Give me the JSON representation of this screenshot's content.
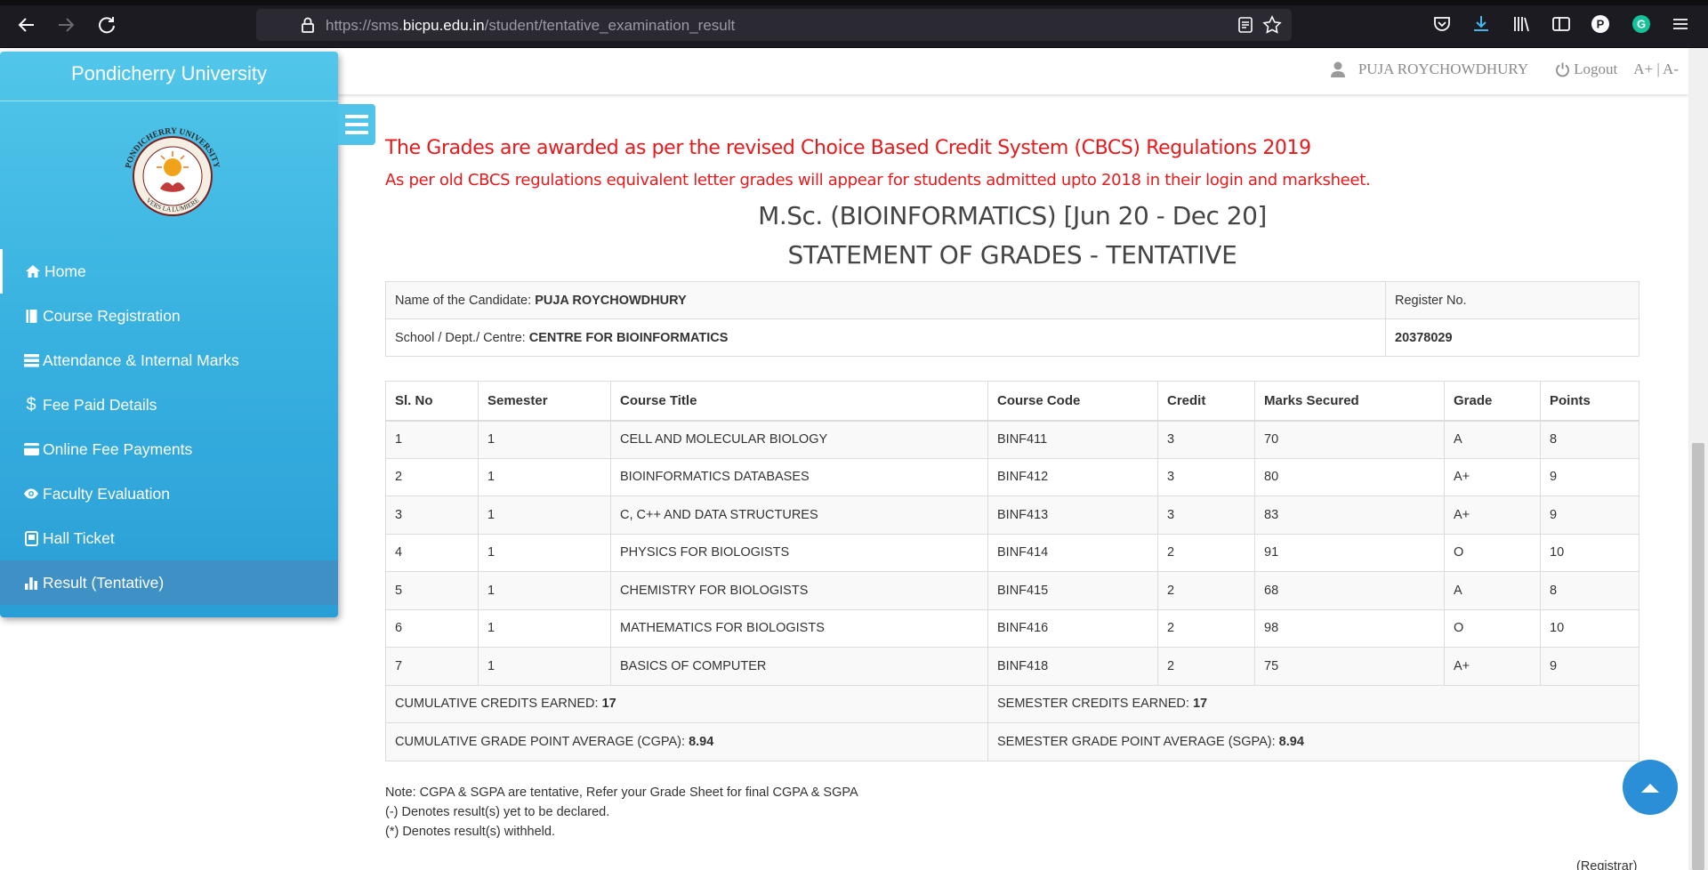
{
  "browser": {
    "url_prefix": "https://sms.",
    "url_host": "bicpu.edu.in",
    "url_path": "/student/tentative_examination_result"
  },
  "header": {
    "user_name": "PUJA ROYCHOWDHURY",
    "logout_label": "Logout",
    "font_size_controls": "A+ | A-"
  },
  "sidebar": {
    "title": "Pondicherry University",
    "logo_text_top": "PONDICHERRY UNIVERSITY",
    "logo_text_bottom": "VERS LA LUMIERE",
    "items": [
      {
        "label": "Home",
        "icon": "home-icon"
      },
      {
        "label": "Course Registration",
        "icon": "book-icon"
      },
      {
        "label": "Attendance & Internal Marks",
        "icon": "list-icon"
      },
      {
        "label": "Fee Paid Details",
        "icon": "dollar-icon"
      },
      {
        "label": "Online Fee Payments",
        "icon": "card-icon"
      },
      {
        "label": "Faculty Evaluation",
        "icon": "eye-icon"
      },
      {
        "label": "Hall Ticket",
        "icon": "ticket-icon"
      },
      {
        "label": "Result (Tentative)",
        "icon": "bar-chart-icon"
      }
    ]
  },
  "notices": {
    "line1": "The Grades are awarded as per the revised Choice Based Credit System (CBCS) Regulations 2019",
    "line2": "As per old CBCS regulations equivalent letter grades will appear for students admitted upto 2018 in their login and marksheet."
  },
  "titles": {
    "program": "M.Sc. (BIOINFORMATICS) [Jun 20 - Dec 20]",
    "statement": "STATEMENT OF GRADES - TENTATIVE"
  },
  "candidate": {
    "name_label": "Name of the Candidate: ",
    "name": "PUJA ROYCHOWDHURY",
    "register_label": "Register No.",
    "school_label": "School / Dept./ Centre: ",
    "school": "CENTRE FOR BIOINFORMATICS",
    "register_no": "20378029"
  },
  "grades": {
    "headers": [
      "Sl. No",
      "Semester",
      "Course Title",
      "Course Code",
      "Credit",
      "Marks Secured",
      "Grade",
      "Points"
    ],
    "rows": [
      [
        "1",
        "1",
        "CELL AND MOLECULAR BIOLOGY",
        "BINF411",
        "3",
        "70",
        "A",
        "8"
      ],
      [
        "2",
        "1",
        "BIOINFORMATICS DATABASES",
        "BINF412",
        "3",
        "80",
        "A+",
        "9"
      ],
      [
        "3",
        "1",
        "C, C++ AND DATA STRUCTURES",
        "BINF413",
        "3",
        "83",
        "A+",
        "9"
      ],
      [
        "4",
        "1",
        "PHYSICS FOR BIOLOGISTS",
        "BINF414",
        "2",
        "91",
        "O",
        "10"
      ],
      [
        "5",
        "1",
        "CHEMISTRY FOR BIOLOGISTS",
        "BINF415",
        "2",
        "68",
        "A",
        "8"
      ],
      [
        "6",
        "1",
        "MATHEMATICS FOR BIOLOGISTS",
        "BINF416",
        "2",
        "98",
        "O",
        "10"
      ],
      [
        "7",
        "1",
        "BASICS OF COMPUTER",
        "BINF418",
        "2",
        "75",
        "A+",
        "9"
      ]
    ],
    "cumulative_credits_label": "CUMULATIVE CREDITS EARNED: ",
    "cumulative_credits": "17",
    "semester_credits_label": "SEMESTER CREDITS EARNED: ",
    "semester_credits": "17",
    "cgpa_label": "CUMULATIVE GRADE POINT AVERAGE (CGPA): ",
    "cgpa": "8.94",
    "sgpa_label": "SEMESTER GRADE POINT AVERAGE (SGPA): ",
    "sgpa": "8.94"
  },
  "notes": [
    "Note: CGPA & SGPA are tentative, Refer your Grade Sheet for final CGPA & SGPA",
    "(-) Denotes result(s) yet to be declared.",
    "(*) Denotes result(s) withheld."
  ],
  "registrar": "(Registrar)",
  "colors": {
    "sidebar_blue": "#3ab3e1",
    "notice_red": "#e8181b",
    "active_item": "#3f90c4",
    "scroll_button": "#2a8fd6"
  }
}
